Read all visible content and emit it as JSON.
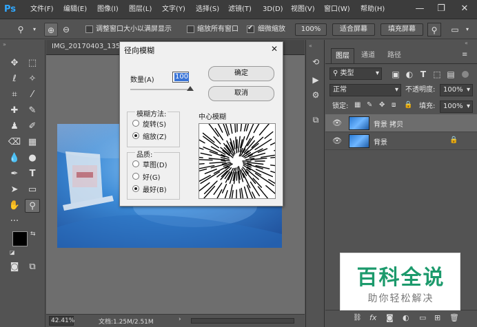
{
  "app": {
    "logo": "Ps"
  },
  "menu": [
    "文件(F)",
    "编辑(E)",
    "图像(I)",
    "图层(L)",
    "文字(Y)",
    "选择(S)",
    "滤镜(T)",
    "3D(D)",
    "视图(V)",
    "窗口(W)",
    "帮助(H)"
  ],
  "options_bar": {
    "resize_windows_label": "调整窗口大小以满屏显示",
    "zoom_all_label": "缩放所有窗口",
    "scrubby_zoom_label": "细微缩放",
    "zoom_value": "100%",
    "fit_screen_label": "适合屏幕",
    "fill_screen_label": "填充屏幕"
  },
  "document": {
    "tab_title": "IMG_20170403_135",
    "zoom": "42.41%",
    "doc_info": "文档:1.25M/2.51M"
  },
  "dialog": {
    "title": "径向模糊",
    "amount_label": "数量(A)",
    "amount_value": "100",
    "ok_label": "确定",
    "cancel_label": "取消",
    "method_label": "模糊方法:",
    "method_spin": "旋转(S)",
    "method_zoom": "缩放(Z)",
    "quality_label": "品质:",
    "quality_draft": "草图(D)",
    "quality_good": "好(G)",
    "quality_best": "最好(B)",
    "center_label": "中心模糊"
  },
  "panels": {
    "tabs": [
      "图层",
      "通道",
      "路径"
    ],
    "kind_label": "类型",
    "blend_mode": "正常",
    "opacity_label": "不透明度:",
    "opacity_value": "100%",
    "lock_label": "锁定:",
    "fill_label": "填充:",
    "fill_value": "100%",
    "layers": [
      {
        "name": "背景 拷贝"
      },
      {
        "name": "背景"
      }
    ]
  },
  "watermark": {
    "title": "百科全说",
    "subtitle": "助你轻松解决"
  },
  "colors": {
    "ps_blue": "#31a8ff",
    "watermark_green": "#1c9a6c"
  }
}
